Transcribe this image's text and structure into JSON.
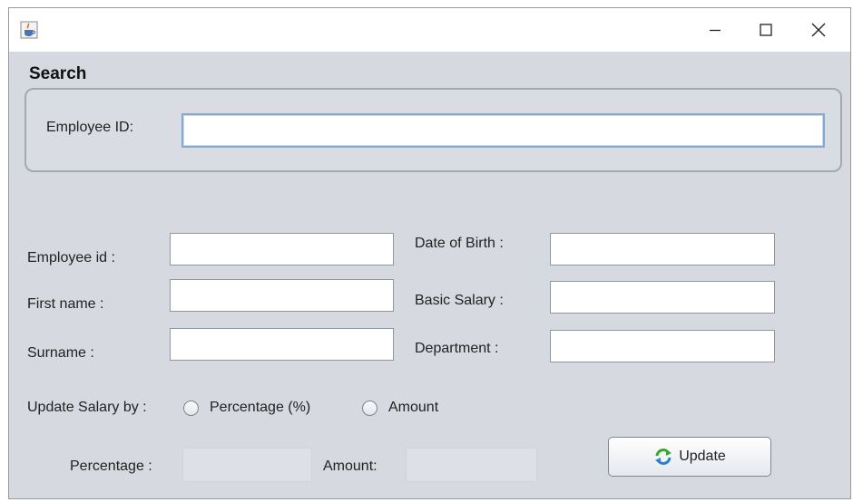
{
  "window": {
    "title": "",
    "app_icon": "java-cup-icon",
    "controls": {
      "minimize": "minimize-icon",
      "maximize": "maximize-icon",
      "close": "close-icon"
    }
  },
  "search": {
    "title": "Search",
    "employee_id_label": "Employee ID:",
    "employee_id_value": ""
  },
  "form": {
    "employee_id_label": "Employee id :",
    "first_name_label": "First name :",
    "surname_label": "Surname :",
    "dob_label": "Date of Birth :",
    "basic_salary_label": "Basic Salary :",
    "department_label": "Department :",
    "update_by_label": "Update Salary by :",
    "option_percentage": "Percentage (%)",
    "option_amount": "Amount",
    "percentage_label": "Percentage :",
    "amount_label": "Amount:",
    "update_button": "Update",
    "update_icon": "refresh-icon"
  },
  "colors": {
    "panel_bg": "#d6d9df",
    "field_border": "#8e98a3",
    "focus_border": "#8aa8c8",
    "refresh_green": "#3aa82c",
    "refresh_blue": "#2f7fd0"
  }
}
